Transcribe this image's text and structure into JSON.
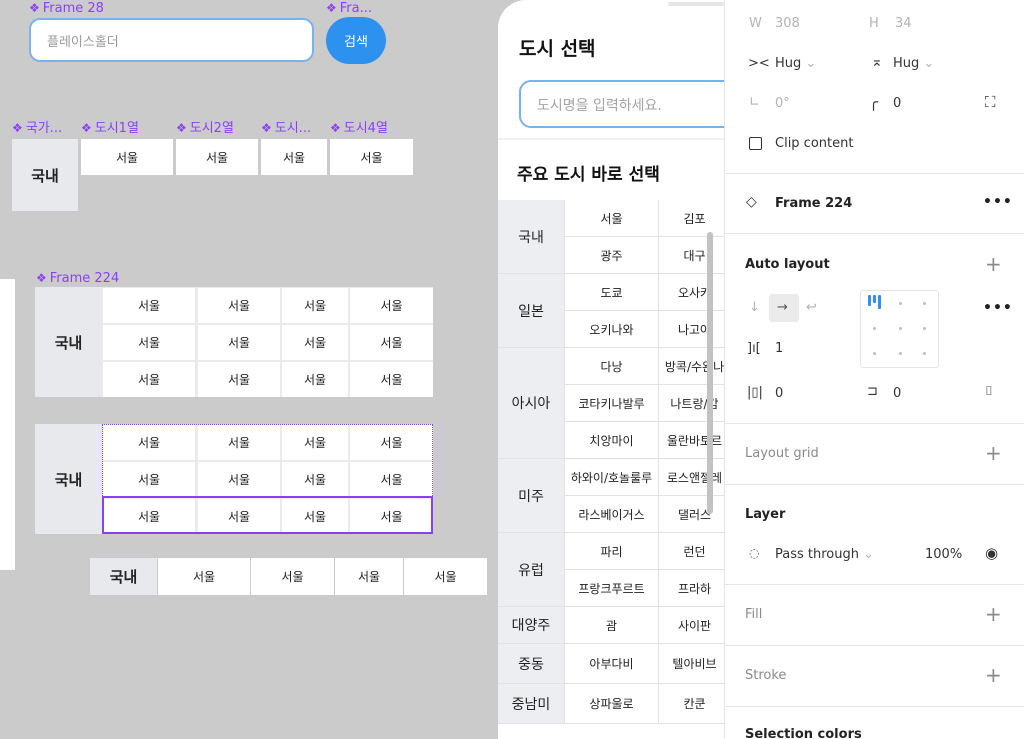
{
  "canvas": {
    "labels": {
      "frame28": "Frame 28",
      "fra": "Fra...",
      "country": "국가...",
      "city1": "도시1열",
      "city2": "도시2열",
      "city3": "도시...",
      "city4": "도시4열",
      "frame224": "Frame 224"
    },
    "search_placeholder": "플레이스홀더",
    "search_button": "검색",
    "region": "국내",
    "city": "서울"
  },
  "mobile": {
    "title": "도시 선택",
    "input_placeholder": "도시명을 입력하세요.",
    "section_title": "주요 도시 바로 선택",
    "regions": [
      {
        "name": "국내",
        "cities": [
          "서울",
          "김포",
          "광주",
          "대구"
        ]
      },
      {
        "name": "일본",
        "cities": [
          "도쿄",
          "오사카",
          "오키나와",
          "나고야"
        ]
      },
      {
        "name": "아시아",
        "cities": [
          "다낭",
          "방콕/수완나",
          "코타키나발루",
          "나트랑/캄",
          "치앙마이",
          "울란바토르"
        ]
      },
      {
        "name": "미주",
        "cities": [
          "하와이/호놀룰루",
          "로스앤젤레",
          "라스베이거스",
          "댈러스"
        ]
      },
      {
        "name": "유럽",
        "cities": [
          "파리",
          "런던",
          "프랑크푸르트",
          "프라하"
        ]
      },
      {
        "name": "대양주",
        "cities": [
          "괌",
          "사이판"
        ]
      },
      {
        "name": "중동",
        "cities": [
          "아부다비",
          "텔아비브"
        ]
      },
      {
        "name": "중남미",
        "cities": [
          "상파울로",
          "칸쿤"
        ]
      }
    ]
  },
  "inspector": {
    "w_label": "W",
    "w_value": "308",
    "h_label": "H",
    "h_value": "34",
    "hug_w": "Hug",
    "hug_h": "Hug",
    "rotation": "0°",
    "radius": "0",
    "clip_content": "Clip content",
    "frame_name": "Frame 224",
    "auto_layout": "Auto layout",
    "gap": "1",
    "padding_h": "0",
    "padding_v": "0",
    "layout_grid": "Layout grid",
    "layer": "Layer",
    "blend": "Pass through",
    "opacity": "100%",
    "fill": "Fill",
    "stroke": "Stroke",
    "selection_colors": "Selection colors"
  },
  "colors": {
    "canvas": "#cbcbcb",
    "component_purple": "#8b3ffd",
    "primary_blue": "#2d92ef",
    "row_header": "#e8e9ec"
  }
}
